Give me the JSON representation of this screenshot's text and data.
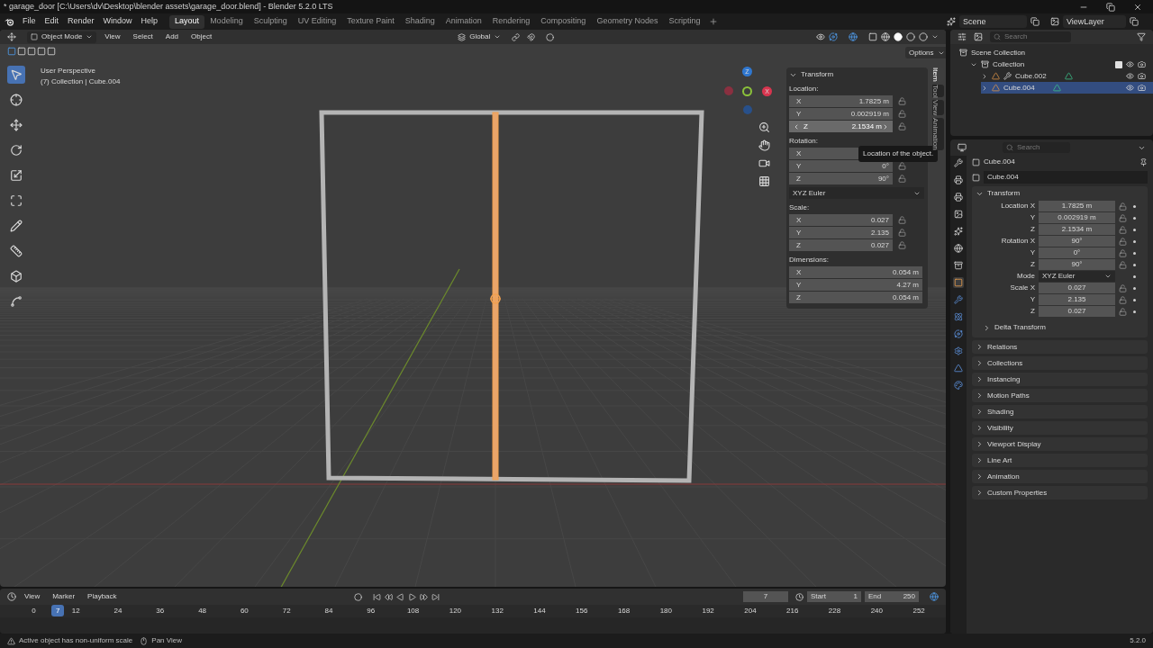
{
  "window": {
    "title": "* garage_door [C:\\Users\\dv\\Desktop\\blender assets\\garage_door.blend] - Blender 5.2.0 LTS"
  },
  "menus": [
    "File",
    "Edit",
    "Render",
    "Window",
    "Help"
  ],
  "workspaces": [
    {
      "label": "Layout",
      "selected": true
    },
    {
      "label": "Modeling",
      "selected": false
    },
    {
      "label": "Sculpting",
      "selected": false
    },
    {
      "label": "UV Editing",
      "selected": false
    },
    {
      "label": "Texture Paint",
      "selected": false
    },
    {
      "label": "Shading",
      "selected": false
    },
    {
      "label": "Animation",
      "selected": false
    },
    {
      "label": "Rendering",
      "selected": false
    },
    {
      "label": "Compositing",
      "selected": false
    },
    {
      "label": "Geometry Nodes",
      "selected": false
    },
    {
      "label": "Scripting",
      "selected": false
    }
  ],
  "scene": {
    "name": "Scene",
    "view_layer": "ViewLayer"
  },
  "viewport": {
    "mode": "Object Mode",
    "menus": [
      "View",
      "Select",
      "Add",
      "Object"
    ],
    "orientation": "Global",
    "options": "Options",
    "overlay_text": [
      "User Perspective",
      "(7) Collection | Cube.004"
    ],
    "gizmo_labels": [
      "Z",
      "X"
    ]
  },
  "sidebar": {
    "tabs": [
      {
        "label": "Item",
        "selected": true
      },
      {
        "label": "Tool",
        "selected": false
      },
      {
        "label": "View",
        "selected": false
      },
      {
        "label": "Animation",
        "selected": false
      }
    ],
    "panel": "Transform",
    "tooltip": "Location of the object.",
    "rotation_mode": "XYZ Euler",
    "groups": [
      {
        "label": "Location:",
        "rows": [
          {
            "axis": "X",
            "value": "1.7825 m",
            "lock": true,
            "active": false
          },
          {
            "axis": "Y",
            "value": "0.002919 m",
            "lock": true,
            "active": false
          },
          {
            "axis": "Z",
            "value": "2.1534 m",
            "lock": true,
            "active": true
          }
        ]
      },
      {
        "label": "Rotation:",
        "rows": [
          {
            "axis": "X",
            "lock": false,
            "active": false
          },
          {
            "axis": "Y",
            "value": "0°",
            "lock": true,
            "active": false
          },
          {
            "axis": "Z",
            "value": "90°",
            "lock": true,
            "active": false
          }
        ]
      },
      {
        "label": "Scale:",
        "rows": [
          {
            "axis": "X",
            "value": "0.027",
            "lock": true,
            "active": false
          },
          {
            "axis": "Y",
            "value": "2.135",
            "lock": true,
            "active": false
          },
          {
            "axis": "Z",
            "value": "0.027",
            "lock": true,
            "active": false
          }
        ]
      },
      {
        "label": "Dimensions:",
        "rows": [
          {
            "axis": "X",
            "value": "0.054 m",
            "lock": false,
            "active": false
          },
          {
            "axis": "Y",
            "value": "4.27 m",
            "lock": false,
            "active": false
          },
          {
            "axis": "Z",
            "value": "0.054 m",
            "lock": false,
            "active": false
          }
        ]
      }
    ]
  },
  "outliner": {
    "search_placeholder": "Search",
    "tree": [
      {
        "label": "Scene Collection",
        "kind": "scene_collection",
        "selected": false,
        "children": [
          {
            "label": "Collection",
            "kind": "collection",
            "expanded": true,
            "checked": true,
            "selected": false,
            "children": [
              {
                "label": "Cube.002",
                "kind": "object",
                "expanded": false,
                "has_modifier": true,
                "selected": false
              },
              {
                "label": "Cube.004",
                "kind": "object",
                "expanded": false,
                "has_modifier": false,
                "selected": true
              }
            ]
          }
        ]
      }
    ]
  },
  "properties": {
    "search_placeholder": "Search",
    "object": "Cube.004",
    "name_field": "Cube.004",
    "panel": "Transform",
    "expanded": true,
    "rows": [
      {
        "label": "Location X",
        "value": "1.7825 m",
        "kind": "number"
      },
      {
        "label": "Y",
        "value": "0.002919 m",
        "kind": "number"
      },
      {
        "label": "Z",
        "value": "2.1534 m",
        "kind": "number"
      },
      {
        "label": "Rotation X",
        "value": "90°",
        "kind": "number"
      },
      {
        "label": "Y",
        "value": "0°",
        "kind": "number"
      },
      {
        "label": "Z",
        "value": "90°",
        "kind": "number"
      },
      {
        "label": "Mode",
        "value": "XYZ Euler",
        "kind": "dropdown"
      },
      {
        "label": "Scale X",
        "value": "0.027",
        "kind": "number"
      },
      {
        "label": "Y",
        "value": "2.135",
        "kind": "number"
      },
      {
        "label": "Z",
        "value": "0.027",
        "kind": "number"
      }
    ],
    "subpanel": "Delta Transform",
    "panels": [
      "Relations",
      "Collections",
      "Instancing",
      "Motion Paths",
      "Shading",
      "Visibility",
      "Viewport Display",
      "Line Art",
      "Animation",
      "Custom Properties"
    ]
  },
  "timeline": {
    "menus": [
      "View",
      "Marker",
      "Playback"
    ],
    "current_frame": "7",
    "start_label": "Start",
    "start": "1",
    "end_label": "End",
    "end": "250",
    "playhead": {
      "label": "7",
      "level": 0.0278
    },
    "ticks": [
      "0",
      "12",
      "24",
      "36",
      "48",
      "60",
      "72",
      "84",
      "96",
      "108",
      "120",
      "132",
      "144",
      "156",
      "168",
      "180",
      "192",
      "204",
      "216",
      "228",
      "240",
      "252"
    ]
  },
  "status_bar": {
    "message": "Active object has non-uniform scale",
    "hint": "Pan View",
    "version": "5.2.0"
  }
}
